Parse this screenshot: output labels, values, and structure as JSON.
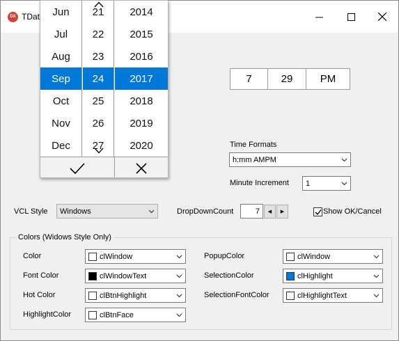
{
  "window": {
    "title": "TDate",
    "app_icon_text": "DX",
    "controls": [
      "minimize-icon",
      "maximize-icon",
      "close-icon"
    ]
  },
  "time_picker": {
    "hour": "7",
    "minute": "29",
    "ampm": "PM"
  },
  "time_formats": {
    "label": "Time Formats",
    "value": "h:mm AMPM"
  },
  "minute_increment": {
    "label": "Minute Increment",
    "value": "1"
  },
  "vcl_style": {
    "label": "VCL Style",
    "value": "Windows"
  },
  "dropdown_count": {
    "label": "DropDownCount",
    "value": "7"
  },
  "show_ok_cancel": {
    "label": "Show OK/Cancel",
    "checked": true
  },
  "colors_group": {
    "title": "Colors (Widows Style Only)",
    "left": [
      {
        "label": "Color",
        "value": "clWindow",
        "swatch": "#ffffff"
      },
      {
        "label": "Font Color",
        "value": "clWindowText",
        "swatch": "#000000"
      },
      {
        "label": "Hot Color",
        "value": "clBtnHighlight",
        "swatch": "#ffffff"
      },
      {
        "label": "HighlightColor",
        "value": "clBtnFace",
        "swatch": "#ffffff"
      }
    ],
    "right": [
      {
        "label": "PopupColor",
        "value": "clWindow",
        "swatch": "#ffffff"
      },
      {
        "label": "SelectionColor",
        "value": "clHighlight",
        "swatch": "#0078d7"
      },
      {
        "label": "SelectionFontColor",
        "value": "clHighlightText",
        "swatch": "#ffffff"
      }
    ]
  },
  "picker": {
    "months": [
      "Jun",
      "Jul",
      "Aug",
      "Sep",
      "Oct",
      "Nov",
      "Dec"
    ],
    "days": [
      "21",
      "22",
      "23",
      "24",
      "25",
      "26",
      "27"
    ],
    "years": [
      "2014",
      "2015",
      "2016",
      "2017",
      "2018",
      "2019",
      "2020"
    ],
    "selected_index": 3,
    "selection_color": "#0078d7",
    "ok_icon": "checkmark-icon",
    "cancel_icon": "x-icon"
  }
}
